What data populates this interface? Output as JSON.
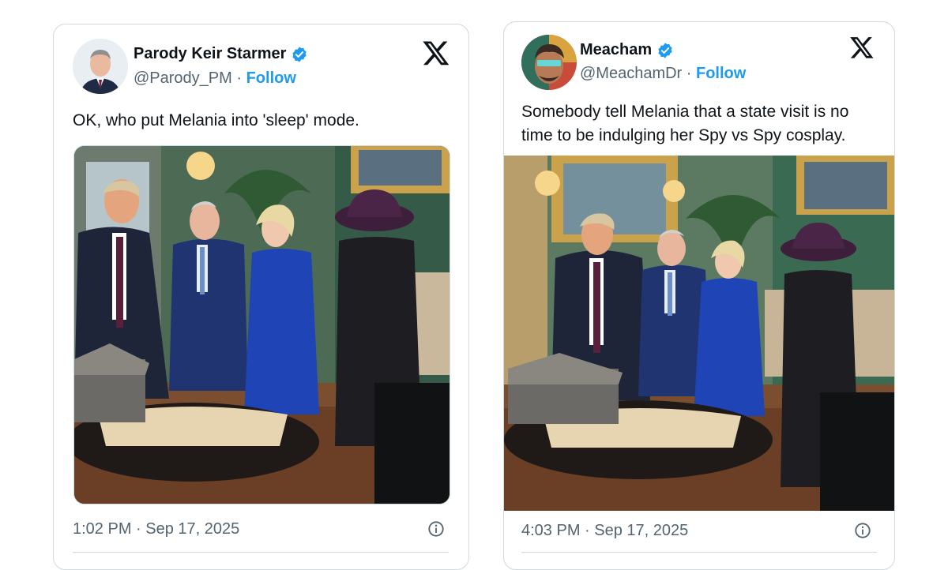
{
  "tweets": [
    {
      "display_name": "Parody Keir Starmer",
      "handle": "@Parody_PM",
      "separator": "·",
      "follow_label": "Follow",
      "text": "OK, who put Melania into 'sleep' mode.",
      "timestamp": "1:02 PM · Sep 17, 2025"
    },
    {
      "display_name": "Meacham",
      "handle": "@MeachamDr",
      "separator": "·",
      "follow_label": "Follow",
      "text_line1": "Somebody tell Melania that a state visit is no",
      "text_line2": "time to be indulging her Spy vs Spy cosplay.",
      "timestamp": "4:03 PM · Sep 17, 2025"
    }
  ],
  "icons": {
    "verified": "verified-badge-icon",
    "x_logo": "x-logo-icon",
    "info": "info-icon"
  },
  "colors": {
    "accent": "#1d9bf0",
    "text": "#0f1419",
    "muted": "#536471",
    "border": "#cfd9de"
  }
}
